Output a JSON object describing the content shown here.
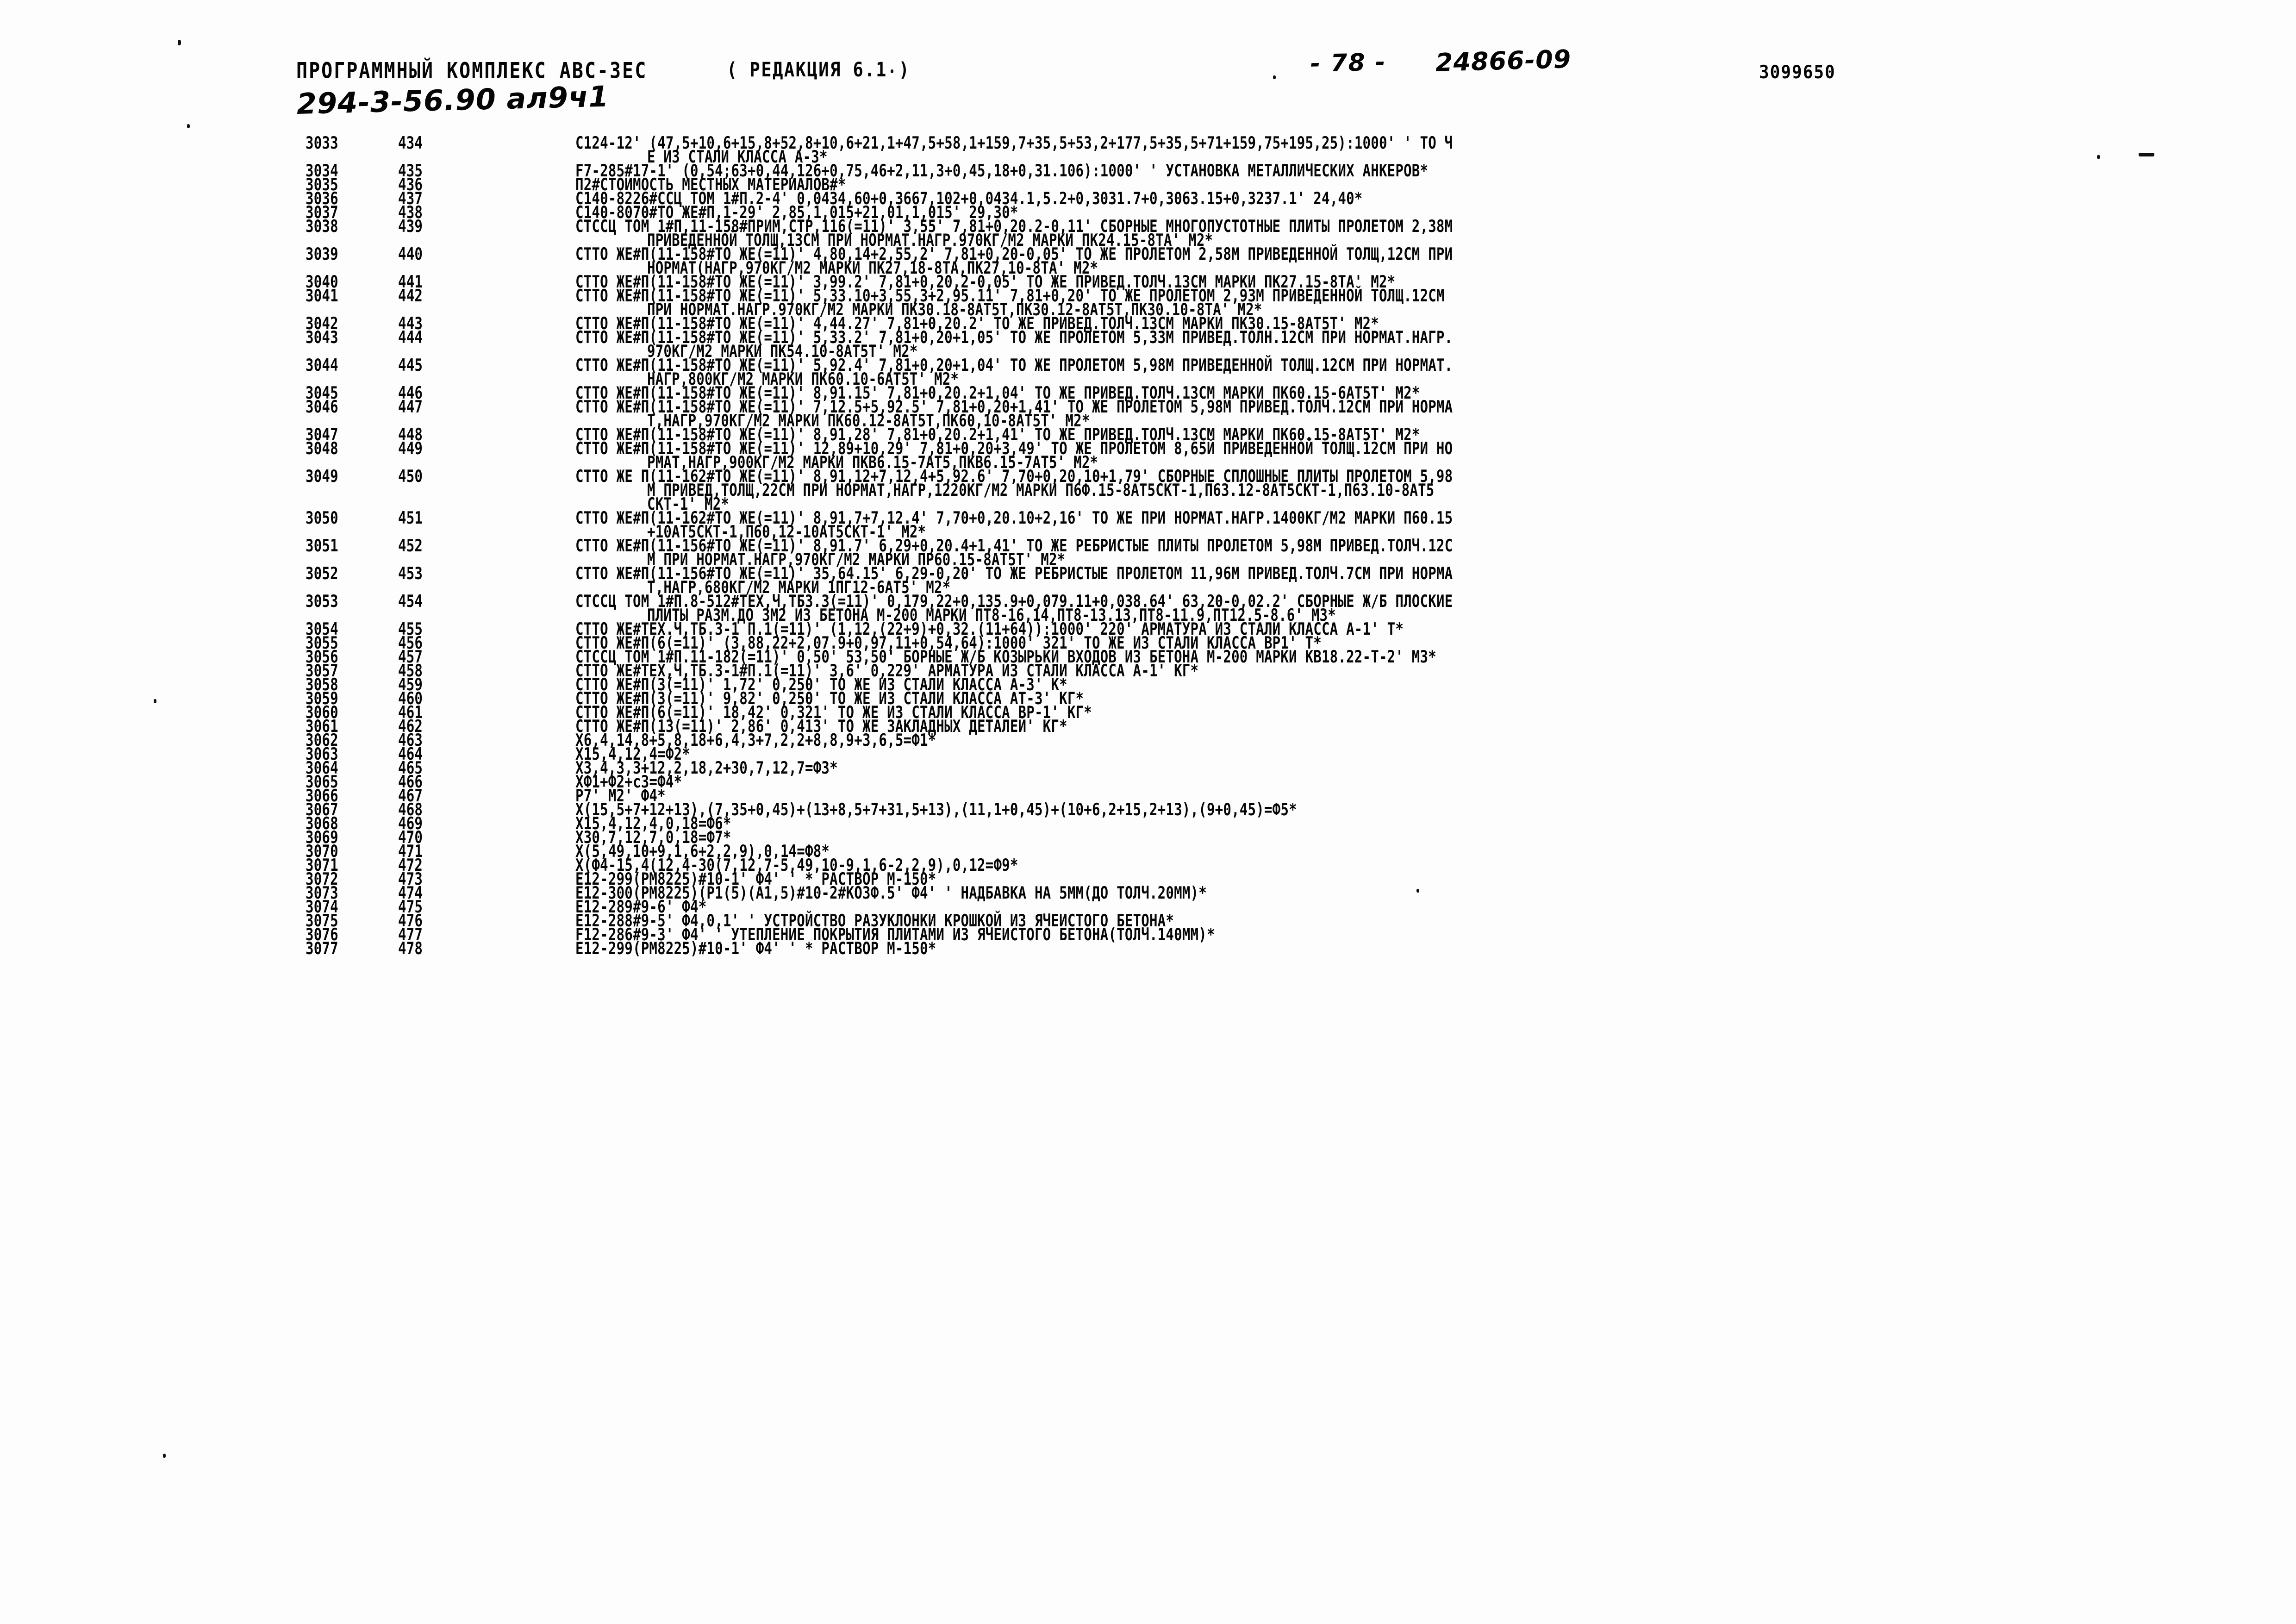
{
  "header": {
    "title": "ПРОГРАММНЫЙ КОМПЛЕКС АВС-3ЕС",
    "revision": "( РЕДАКЦИЯ 6.1 )",
    "page_marker": "- 78 -",
    "doc_code": "24866-09",
    "serial": "3099650",
    "handwritten_stamp": "294-3-56.90 ал9ч1"
  },
  "listing": {
    "columns": [
      "seq",
      "stmt",
      "text"
    ],
    "rows": [
      {
        "seq": "3033",
        "stmt": "434",
        "text": "C124-12' (47,5+10,6+15,8+52,8+10,6+21,1+47,5+58,1+159,7+35,5+53,2+177,5+35,5+71+159,75+195,25):1000' ' ТО Ч",
        "cont": [
          "Е ИЗ СТАЛИ КЛАССА А-3*"
        ]
      },
      {
        "seq": "3034",
        "stmt": "435",
        "text": "F7-285#17-1' (0,54;63+0,44,126+0,75,46+2,11,3+0,45,18+0,31.106):1000' ' УСТАНОВКА МЕТАЛЛИЧЕСКИХ АНКЕРОВ*",
        "cont": []
      },
      {
        "seq": "3035",
        "stmt": "436",
        "text": "П2#СТОИМОСТЬ МЕСТНЫХ МАТЕРИАЛОВ#*",
        "cont": []
      },
      {
        "seq": "3036",
        "stmt": "437",
        "text": "C140-8226#ССЦ ТОМ 1#П.2-4' 0,0434,60+0,3667,102+0,0434.1,5.2+0,3031.7+0,3063.15+0,3237.1' 24,40*",
        "cont": []
      },
      {
        "seq": "3037",
        "stmt": "438",
        "text": "C140-8070#ТО ЖЕ#П,1-29' 2,85,1,015+21,01,1,015' 29,30*",
        "cont": []
      },
      {
        "seq": "3038",
        "stmt": "439",
        "text": "СТССЦ ТОМ 1#П,11-158#ПРИМ,СТР,116(=11)' 3,55' 7,81+0,20.2-0,11' СБОРНЫЕ МНОГОПУСТОТНЫЕ ПЛИТЫ ПРОЛЕТОМ 2,38М",
        "cont": [
          "ПРИВЕДЕННОЙ ТОЛЩ,13СМ ПРИ НОРМАТ.НАГР.970КГ/М2 МАРКИ ПК24.15-8ТА' М2*"
        ]
      },
      {
        "seq": "3039",
        "stmt": "440",
        "text": "СТТО ЖЕ#П(11-158#ТО ЖЕ(=11)' 4,80,14+2,55,2' 7,81+0,20-0,05' ТО ЖЕ ПРОЛЕТОМ 2,58М ПРИВЕДЕННОЙ ТОЛЩ,12СМ ПРИ",
        "cont": [
          "НОРМАТ(НАГР,970КГ/М2 МАРКИ ПК27,18-8ТА,ПК27,10-8ТА' М2*"
        ]
      },
      {
        "seq": "3040",
        "stmt": "441",
        "text": "СТТО ЖЕ#П(11-158#ТО ЖЕ(=11)' 3,99.2' 7,81+0,20,2-0,05' ТО ЖЕ ПРИВЕД.ТОЛЧ.13СМ МАРКИ ПК27.15-8ТА' М2*",
        "cont": []
      },
      {
        "seq": "3041",
        "stmt": "442",
        "text": "СТТО ЖЕ#П(11-158#ТО ЖЕ(=11)' 5,33.10+3,55,3+2,95.11' 7,81+0,20' ТО ЖЕ ПРОЛЕТОМ 2,93М ПРИВЕДЕННОЙ ТОЛЩ.12СМ",
        "cont": [
          "ПРИ НОРМАТ.НАГР.970КГ/М2 МАРКИ ПК30.18-8АТ5Т,ПК30.12-8АТ5Т,ПК30.10-8ТА' М2*"
        ]
      },
      {
        "seq": "3042",
        "stmt": "443",
        "text": "СТТО ЖЕ#П(11-158#ТО ЖЕ(=11)' 4,44.27' 7,81+0,20.2' ТО ЖЕ ПРИВЕД.ТОЛЧ.13СМ МАРКИ ПК30.15-8АТ5Т' М2*",
        "cont": []
      },
      {
        "seq": "3043",
        "stmt": "444",
        "text": "СТТО ЖЕ#П(11-158#ТО ЖЕ(=11)' 5,33.2' 7,81+0,20+1,05' ТО ЖЕ ПРОЛЕТОМ 5,33М ПРИВЕД.ТОЛН.12СМ ПРИ НОРМАТ.НАГР.",
        "cont": [
          "970КГ/М2 МАРКИ ПК54.10-8АТ5Т' М2*"
        ]
      },
      {
        "seq": "3044",
        "stmt": "445",
        "text": "СТТО ЖЕ#П(11-158#ТО ЖЕ(=11)' 5,92.4' 7,81+0,20+1,04' ТО ЖЕ ПРОЛЕТОМ 5,98М ПРИВЕДЕННОЙ ТОЛЩ.12СМ ПРИ НОРМАТ.",
        "cont": [
          "НАГР,800КГ/М2 МАРКИ ПК60.10-6АТ5Т' М2*"
        ]
      },
      {
        "seq": "3045",
        "stmt": "446",
        "text": "СТТО ЖЕ#П(11-158#ТО ЖЕ(=11)' 8,91.15' 7,81+0,20.2+1,04' ТО ЖЕ ПРИВЕД.ТОЛЧ.13СМ МАРКИ ПК60.15-6АТ5Т' М2*",
        "cont": []
      },
      {
        "seq": "3046",
        "stmt": "447",
        "text": "СТТО ЖЕ#П(11-158#ТО ЖЕ(=11)' 7,12.5+5,92.5' 7,81+0,20+1,41' ТО ЖЕ ПРОЛЕТОМ 5,98М ПРИВЕД.ТОЛЧ.12СМ ПРИ НОРМА",
        "cont": [
          "Т,НАГР,970КГ/М2 МАРКИ ПК60.12-8АТ5Т,ПК60,10-8АТ5Т' М2*"
        ]
      },
      {
        "seq": "3047",
        "stmt": "448",
        "text": "СТТО ЖЕ#П(11-158#ТО ЖЕ(=11)' 8,91,28' 7,81+0,20.2+1,41' ТО ЖЕ ПРИВЕД.ТОЛЧ.13СМ МАРКИ ПК60.15-8АТ5Т' М2*",
        "cont": []
      },
      {
        "seq": "3048",
        "stmt": "449",
        "text": "СТТО ЖЕ#П(11-158#ТО ЖЕ(=11)' 12,89+10,29' 7,81+0,20+3,49' ТО ЖЕ ПРОЛЕТОМ 8,65Й ПРИВЕДЕННОЙ ТОЛЩ.12СМ ПРИ НО",
        "cont": [
          "РМАТ,НАГР,900КГ/М2 МАРКИ ПКВ6.15-7АТ5,ПКВ6.15-7АТ5' М2*"
        ]
      },
      {
        "seq": "3049",
        "stmt": "450",
        "text": "СТТО ЖЕ П(11-162#ТО ЖЕ(=11)' 8,91,12+7,12,4+5,92.6' 7,70+0,20,10+1,79' СБОРНЫЕ СПЛОШНЫЕ ПЛИТЫ ПРОЛЕТОМ 5,98",
        "cont": [
          "М ПРИВЕД,ТОЛЩ,22СМ ПРИ НОРМАТ,НАГР,1220КГ/М2 МАРКИ П6Ф.15-8АТ5СКТ-1,П63.12-8АТ5СКТ-1,П63.10-8АТ5",
          "СКТ-1' М2*"
        ]
      },
      {
        "seq": "3050",
        "stmt": "451",
        "text": "СТТО ЖЕ#П(11-162#ТО ЖЕ(=11)' 8,91,7+7,12.4' 7,70+0,20.10+2,16' ТО ЖЕ ПРИ НОРМАТ.НАГР.1400КГ/М2 МАРКИ П60.15",
        "cont": [
          "+10АТ5СКТ-1,П60,12-10АТ5СКТ-1' М2*"
        ]
      },
      {
        "seq": "3051",
        "stmt": "452",
        "text": "СТТО ЖЕ#П(11-156#ТО ЖЕ(=11)' 8,91.7' 6,29+0,20.4+1,41' ТО ЖЕ РЕБРИСТЫЕ ПЛИТЫ ПРОЛЕТОМ 5,98М ПРИВЕД.ТОЛЧ.12С",
        "cont": [
          "М ПРИ НОРМАТ.НАГР,970КГ/М2 МАРКИ ПР60.15-8АТ5Т' М2*"
        ]
      },
      {
        "seq": "3052",
        "stmt": "453",
        "text": "СТТО ЖЕ#П(11-156#ТО ЖЕ(=11)' 35,64.15' 6,29-0,20' ТО ЖЕ РЕБРИСТЫЕ ПРОЛЕТОМ 11,96М ПРИВЕД.ТОЛЧ.7СМ ПРИ НОРМА",
        "cont": [
          "Т,НАГР,680КГ/М2 МАРКИ 1ПГ12-6АТ5' М2*"
        ]
      },
      {
        "seq": "3053",
        "stmt": "454",
        "text": "СТССЦ ТОМ 1#П.8-512#ТЕХ,Ч,ТБ3.3(=11)' 0,179,22+0,135.9+0,079.11+0,038.64' 63,20-0,02.2' СБОРНЫЕ Ж/Б ПЛОСКИЕ",
        "cont": [
          "ПЛИТЫ РАЗМ.ДО 3М2 ИЗ БЕТОНА М-200 МАРКИ ПТ8-16,14,ПТ8-13.13,ПТ8-11.9,ПТ12.5-8.6' М3*"
        ]
      },
      {
        "seq": "3054",
        "stmt": "455",
        "text": "СТТО ЖЕ#ТЕХ.Ч,ТБ.3-1 П.1(=11)' (1,12,(22+9)+0,32.(11+64)):1000' 220' АРМАТУРА ИЗ СТАЛИ КЛАССА А-1' Т*",
        "cont": []
      },
      {
        "seq": "3055",
        "stmt": "456",
        "text": "СТТО ЖЕ#П(6(=11)' (3,88,22+2,07.9+0,97,11+0,54,64):1000' 321' ТО ЖЕ ИЗ СТАЛИ КЛАССА ВР1' Т*",
        "cont": []
      },
      {
        "seq": "3056",
        "stmt": "457",
        "text": "СТССЦ ТОМ 1#П.11-182(=11)' 0,50' 53,50' БОРНЫЕ Ж/Б КОЗЫРЬКИ ВХОДОВ ИЗ БЕТОНА М-200 МАРКИ КВ18.22-Т-2' М3*",
        "cont": []
      },
      {
        "seq": "3057",
        "stmt": "458",
        "text": "СТТО ЖЕ#ТЕХ,Ч,ТБ.3-1#П.1(=11)' 3,6' 0,229' АРМАТУРА ИЗ СТАЛИ КЛАССА А-1' КГ*",
        "cont": []
      },
      {
        "seq": "3058",
        "stmt": "459",
        "text": "СТТО ЖЕ#П(3(=11)' 1,72' 0,250' ТО ЖЕ ИЗ СТАЛИ КЛАССА А-3' К*",
        "cont": []
      },
      {
        "seq": "3059",
        "stmt": "460",
        "text": "СТТО ЖЕ#П(3(=11)' 9,82' 0,250' ТО ЖЕ ИЗ СТАЛИ КЛАССА АТ-3' КГ*",
        "cont": []
      },
      {
        "seq": "3060",
        "stmt": "461",
        "text": "СТТО ЖЕ#П(6(=11)' 18,42' 0,321' ТО ЖЕ ИЗ СТАЛИ КЛАССА ВР-1' КГ*",
        "cont": []
      },
      {
        "seq": "3061",
        "stmt": "462",
        "text": "СТТО ЖЕ#П(13(=11)' 2,86' 0,413' ТО ЖЕ ЗАКЛАДНЫХ ДЕТАЛЕЙ' КГ*",
        "cont": []
      },
      {
        "seq": "3062",
        "stmt": "463",
        "text": "X6,4,14,8+5,8,18+6,4,3+7,2,2+8,8,9+3,6,5=Ф1*",
        "cont": []
      },
      {
        "seq": "3063",
        "stmt": "464",
        "text": "X15,4,12,4=Ф2*",
        "cont": []
      },
      {
        "seq": "3064",
        "stmt": "465",
        "text": "X3,4,3,3+12,2,18,2+30,7,12,7=Ф3*",
        "cont": []
      },
      {
        "seq": "3065",
        "stmt": "466",
        "text": "XФ1+Ф2+сЗ=Ф4*",
        "cont": []
      },
      {
        "seq": "3066",
        "stmt": "467",
        "text": "P7' M2' Ф4*",
        "cont": []
      },
      {
        "seq": "3067",
        "stmt": "468",
        "text": "X(15,5+7+12+13),(7,35+0,45)+(13+8,5+7+31,5+13),(11,1+0,45)+(10+6,2+15,2+13),(9+0,45)=Ф5*",
        "cont": []
      },
      {
        "seq": "3068",
        "stmt": "469",
        "text": "X15,4,12,4,0,18=Ф6*",
        "cont": []
      },
      {
        "seq": "3069",
        "stmt": "470",
        "text": "X30,7,12,7,0,18=Ф7*",
        "cont": []
      },
      {
        "seq": "3070",
        "stmt": "471",
        "text": "X(5,49,10+9,1,6+2,2,9),0,14=Ф8*",
        "cont": []
      },
      {
        "seq": "3071",
        "stmt": "472",
        "text": "X(Ф4-15,4(12,4-30(7,12,7-5,49,10-9,1,6-2,2,9),0,12=Ф9*",
        "cont": []
      },
      {
        "seq": "3072",
        "stmt": "473",
        "text": "E12-299(PM8225)#10-1' Ф4' ' * РАСТВОР М-150*",
        "cont": []
      },
      {
        "seq": "3073",
        "stmt": "474",
        "text": "E12-300(PM8225)(P1(5)(A1,5)#10-2#КО3Ф.5' Ф4' ' НАДБАВКА НА 5ММ(ДО ТОЛЧ.20ММ)*",
        "cont": []
      },
      {
        "seq": "3074",
        "stmt": "475",
        "text": "E12-289#9-6' Ф4*",
        "cont": []
      },
      {
        "seq": "3075",
        "stmt": "476",
        "text": "E12-288#9-5' Ф4,0,1' ' УСТРОЙСТВО РАЗУКЛОНКИ КРОШКОЙ ИЗ ЯЧЕИСТОГО БЕТОНА*",
        "cont": []
      },
      {
        "seq": "3076",
        "stmt": "477",
        "text": "F12-286#9-3' Ф4' ' УТЕПЛЕНИЕ ПОКРЫТИЯ ПЛИТАМИ ИЗ ЯЧЕИСТОГО БЕТОНА(ТОЛЧ.140ММ)*",
        "cont": []
      },
      {
        "seq": "3077",
        "stmt": "478",
        "text": "E12-299(PM8225)#10-1' Ф4' ' * РАСТВОР М-150*",
        "cont": []
      }
    ]
  },
  "marks": {
    "right_dash": "-"
  }
}
